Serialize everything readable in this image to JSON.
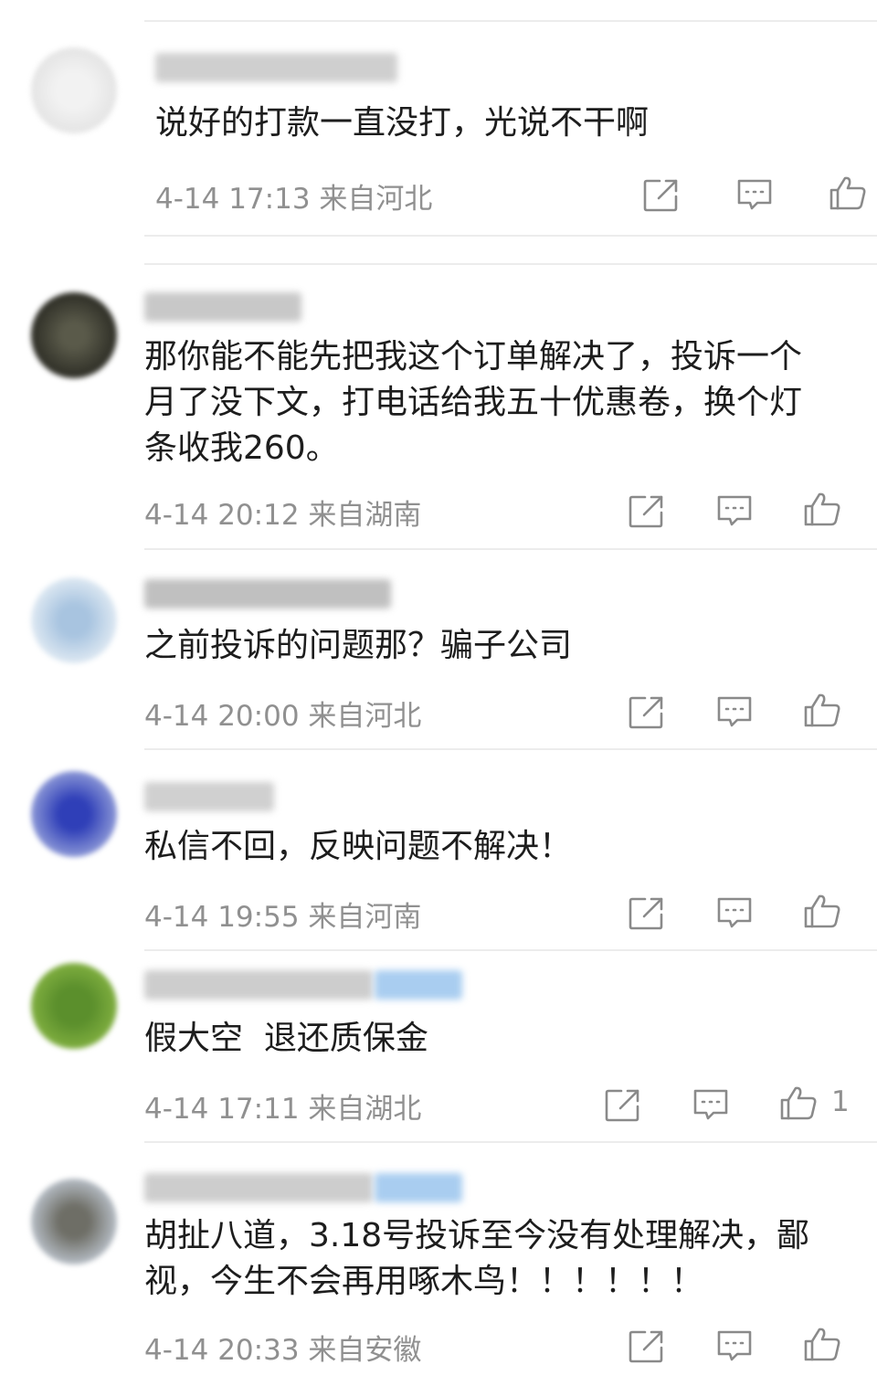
{
  "comments": [
    {
      "text": "说好的打款一直没打，光说不干啊",
      "time": "4-14 17:13",
      "location": "来自河北",
      "like_count": ""
    },
    {
      "text": "那你能不能先把我这个订单解决了，投诉一个\n月了没下文，打电话给我五十优惠卷，换个灯\n条收我260。",
      "time": "4-14 20:12",
      "location": "来自湖南",
      "like_count": ""
    },
    {
      "text": "之前投诉的问题那？骗子公司",
      "time": "4-14 20:00",
      "location": "来自河北",
      "like_count": ""
    },
    {
      "text": "私信不回，反映问题不解决！",
      "time": "4-14 19:55",
      "location": "来自河南",
      "like_count": ""
    },
    {
      "text": "假大空  退还质保金",
      "time": "4-14 17:11",
      "location": "来自湖北",
      "like_count": "1"
    },
    {
      "text": "胡扯八道，3.18号投诉至今没有处理解决，鄙\n视，今生不会再用啄木鸟！！！！！！",
      "time": "4-14 20:33",
      "location": "来自安徽",
      "like_count": ""
    }
  ],
  "icons": {
    "share": "share-icon",
    "reply": "comment-icon",
    "like": "thumbs-up-icon"
  },
  "colors": {
    "meta": "#909090",
    "icon": "#8a8a8a",
    "divider": "#ececec"
  }
}
